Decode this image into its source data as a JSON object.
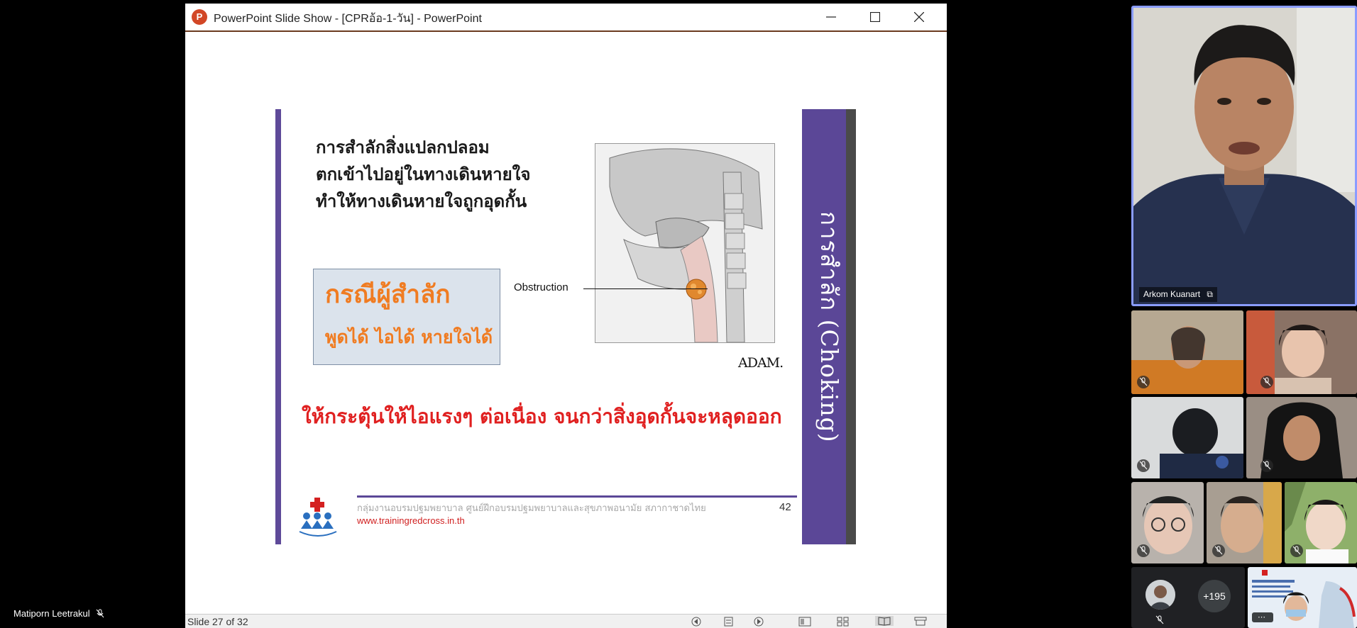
{
  "window": {
    "app_icon_letter": "P",
    "title": "PowerPoint Slide Show - [CPRอ้อ-1-วัน] - PowerPoint"
  },
  "slide": {
    "intro_lines": [
      "การสำลักสิ่งแปลกปลอม",
      "ตกเข้าไปอยู่ในทางเดินหายใจ",
      "ทำให้ทางเดินหายใจถูกอุดกั้น"
    ],
    "case_box": {
      "title": "กรณีผู้สำลัก",
      "subtitle": "พูดได้ ไอได้ หายใจได้"
    },
    "obstruction_label": "Obstruction",
    "adam_logo": "ADAM.",
    "warning": "ให้กระตุ้นให้ไอแรงๆ ต่อเนื่อง จนกว่าสิ่งอุดกั้นจะหลุดออก",
    "side_title": "การสำลัก (Choking)",
    "footer_org": "กลุ่มงานอบรมปฐมพยาบาล ศูนย์ฝึกอบรมปฐมพยาบาลและสุขภาพอนามัย สภากาชาดไทย",
    "footer_url": "www.trainingredcross.in.th",
    "page_number": "42",
    "colors": {
      "purple_band": "#5b4797",
      "orange": "#f07c22",
      "red": "#e02020"
    }
  },
  "statusbar": {
    "slide_counter": "Slide 27 of 32"
  },
  "speaker": {
    "name": "Matiporn Leetrakul",
    "mic_icon": "mic-off-icon"
  },
  "participants": {
    "main": {
      "name": "Arkom Kuanart",
      "pin_icon": "pin-icon"
    },
    "more_count": "+195"
  }
}
